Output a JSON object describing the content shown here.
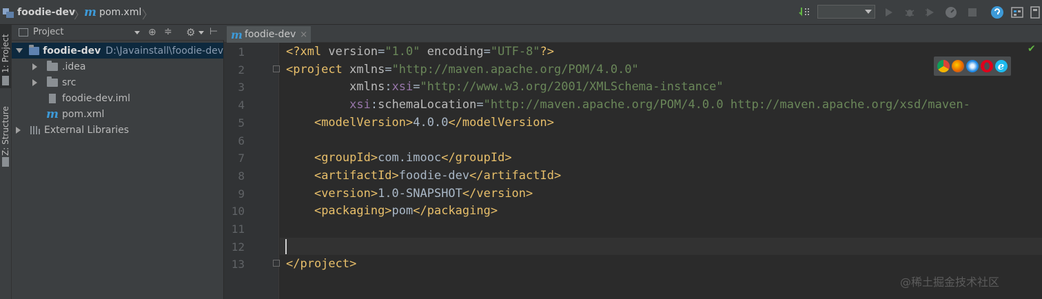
{
  "breadcrumb": {
    "project": "foodie-dev",
    "file_icon": "m",
    "file": "pom.xml"
  },
  "toolbar": {
    "run_config": ""
  },
  "tool_strip": {
    "project_label": "1: Project",
    "structure_label": "Z: Structure"
  },
  "project_panel": {
    "title": "Project",
    "root": {
      "name": "foodie-dev",
      "path": "D:\\Javainstall\\foodie-dev"
    },
    "items": [
      {
        "label": ".idea"
      },
      {
        "label": "src"
      },
      {
        "label": "foodie-dev.iml"
      },
      {
        "label": "pom.xml"
      },
      {
        "label": "External Libraries"
      }
    ]
  },
  "editor": {
    "tab_icon": "m",
    "tab_label": "foodie-dev",
    "tab_close": "×",
    "line_numbers": [
      "1",
      "2",
      "3",
      "4",
      "5",
      "6",
      "7",
      "8",
      "9",
      "10",
      "11",
      "12",
      "13"
    ],
    "lines": [
      {
        "segments": [
          {
            "c": "tag",
            "t": "<?xml "
          },
          {
            "c": "attr",
            "t": "version"
          },
          {
            "c": "txt",
            "t": "="
          },
          {
            "c": "str",
            "t": "\"1.0\""
          },
          {
            "c": "attr",
            "t": " encoding"
          },
          {
            "c": "txt",
            "t": "="
          },
          {
            "c": "str",
            "t": "\"UTF-8\""
          },
          {
            "c": "tag",
            "t": "?>"
          }
        ]
      },
      {
        "segments": [
          {
            "c": "tag",
            "t": "<project "
          },
          {
            "c": "attr",
            "t": "xmlns"
          },
          {
            "c": "txt",
            "t": "="
          },
          {
            "c": "str",
            "t": "\"http://maven.apache.org/POM/4.0.0\""
          }
        ]
      },
      {
        "segments": [
          {
            "c": "txt",
            "t": "         "
          },
          {
            "c": "attr",
            "t": "xmlns"
          },
          {
            "c": "txt",
            "t": ":"
          },
          {
            "c": "ns",
            "t": "xsi"
          },
          {
            "c": "txt",
            "t": "="
          },
          {
            "c": "str",
            "t": "\"http://www.w3.org/2001/XMLSchema-instance\""
          }
        ]
      },
      {
        "segments": [
          {
            "c": "txt",
            "t": "         "
          },
          {
            "c": "ns",
            "t": "xsi"
          },
          {
            "c": "txt",
            "t": ":"
          },
          {
            "c": "attr",
            "t": "schemaLocation"
          },
          {
            "c": "txt",
            "t": "="
          },
          {
            "c": "str",
            "t": "\"http://maven.apache.org/POM/4.0.0 http://maven.apache.org/xsd/maven-"
          }
        ]
      },
      {
        "segments": [
          {
            "c": "txt",
            "t": "    "
          },
          {
            "c": "tag",
            "t": "<modelVersion>"
          },
          {
            "c": "txt",
            "t": "4.0.0"
          },
          {
            "c": "tag",
            "t": "</modelVersion>"
          }
        ]
      },
      {
        "segments": []
      },
      {
        "segments": [
          {
            "c": "txt",
            "t": "    "
          },
          {
            "c": "tag",
            "t": "<groupId>"
          },
          {
            "c": "txt",
            "t": "com.imooc"
          },
          {
            "c": "tag",
            "t": "</groupId>"
          }
        ]
      },
      {
        "segments": [
          {
            "c": "txt",
            "t": "    "
          },
          {
            "c": "tag",
            "t": "<artifactId>"
          },
          {
            "c": "txt",
            "t": "foodie-dev"
          },
          {
            "c": "tag",
            "t": "</artifactId>"
          }
        ]
      },
      {
        "segments": [
          {
            "c": "txt",
            "t": "    "
          },
          {
            "c": "tag",
            "t": "<version>"
          },
          {
            "c": "txt",
            "t": "1.0-SNAPSHOT"
          },
          {
            "c": "tag",
            "t": "</version>"
          }
        ]
      },
      {
        "segments": [
          {
            "c": "txt",
            "t": "    "
          },
          {
            "c": "tag",
            "t": "<packaging>"
          },
          {
            "c": "txt",
            "t": "pom"
          },
          {
            "c": "tag",
            "t": "</packaging>"
          }
        ]
      },
      {
        "segments": []
      },
      {
        "segments": []
      },
      {
        "segments": [
          {
            "c": "tag",
            "t": "</project>"
          }
        ]
      }
    ]
  },
  "watermark": "@稀土掘金技术社区",
  "colors": {
    "tag": "#e8bf6a",
    "string": "#6a8759",
    "namespace": "#9876aa",
    "selection": "#0d293e",
    "accent": "#3d9ad8"
  }
}
